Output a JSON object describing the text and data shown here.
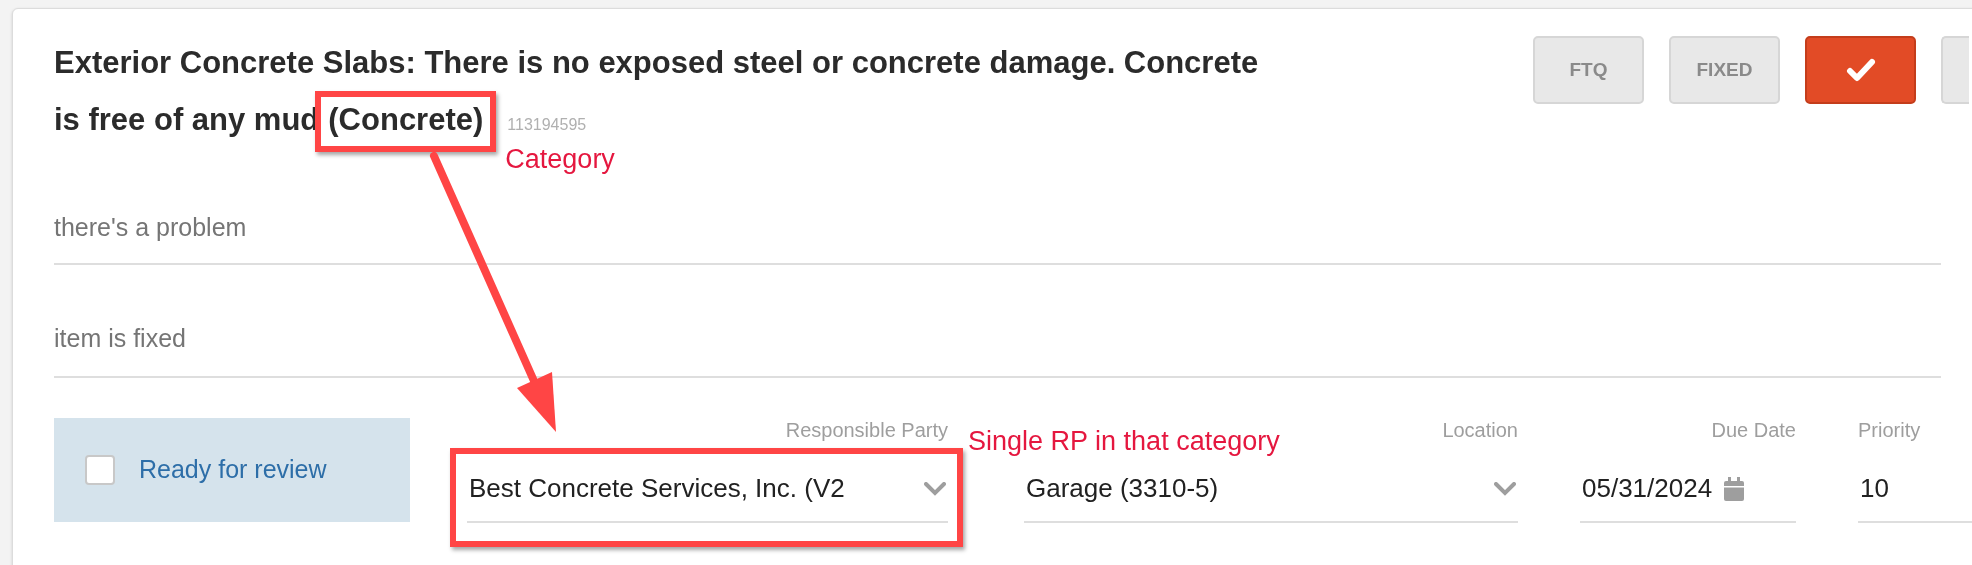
{
  "item": {
    "title_lines": [
      "Exterior Concrete Slabs: There is no exposed steel or concrete damage. Concrete",
      "is free of any mud"
    ],
    "category": "(Concrete)",
    "id": "113194595"
  },
  "actions": [
    {
      "kind": "text",
      "label": "FTQ",
      "selected": false
    },
    {
      "kind": "text",
      "label": "FIXED",
      "selected": false
    },
    {
      "kind": "check",
      "selected": true
    },
    {
      "kind": "partial",
      "selected": false
    }
  ],
  "notes": [
    {
      "placeholder": "there's a problem"
    },
    {
      "placeholder": "item is fixed"
    }
  ],
  "ready_for_review": {
    "label": "Ready for review",
    "checked": false
  },
  "fields": [
    {
      "kind": "select",
      "label": "Responsible Party",
      "value": "Best Concrete Services, Inc. (V2"
    },
    {
      "kind": "select",
      "label": "Location",
      "value": "Garage (3310-5)"
    },
    {
      "kind": "date",
      "label": "Due Date",
      "value": "05/31/2024"
    },
    {
      "kind": "text",
      "label": "Priority",
      "value": "10"
    }
  ],
  "annotations": [
    {
      "text": "Category"
    },
    {
      "text": "Single RP in that category"
    }
  ]
}
